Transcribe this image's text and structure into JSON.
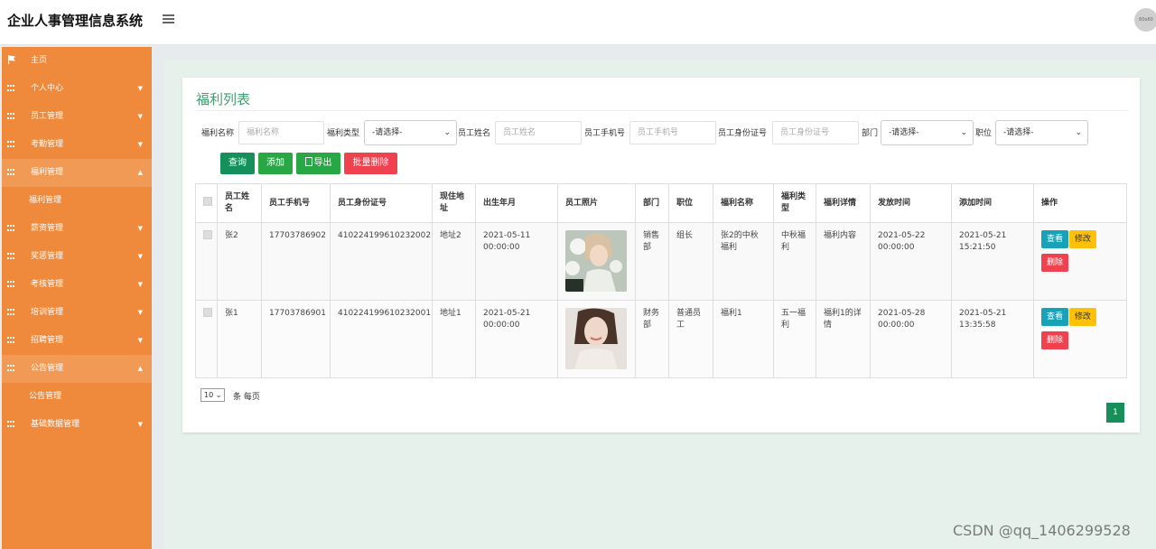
{
  "header": {
    "title": "企业人事管理信息系统",
    "avatar_text": "60x60"
  },
  "sidebar": {
    "items": [
      {
        "label": "主页",
        "icon": "flag-icon"
      },
      {
        "label": "个人中心",
        "icon": "grid-icon"
      },
      {
        "label": "员工管理",
        "icon": "grid-icon"
      },
      {
        "label": "考勤管理",
        "icon": "grid-icon"
      },
      {
        "label": "福利管理",
        "icon": "grid-icon",
        "expanded": true,
        "sub": "福利管理"
      },
      {
        "label": "薪资管理",
        "icon": "grid-icon"
      },
      {
        "label": "奖惩管理",
        "icon": "grid-icon"
      },
      {
        "label": "考核管理",
        "icon": "grid-icon"
      },
      {
        "label": "培训管理",
        "icon": "grid-icon"
      },
      {
        "label": "招聘管理",
        "icon": "grid-icon"
      },
      {
        "label": "公告管理",
        "icon": "grid-icon",
        "expanded": true,
        "sub": "公告管理"
      },
      {
        "label": "基础数据管理",
        "icon": "grid-icon"
      }
    ]
  },
  "panel": {
    "title": "福利列表"
  },
  "filters": {
    "welfare_name": {
      "label": "福利名称",
      "placeholder": "福利名称"
    },
    "welfare_type": {
      "label": "福利类型",
      "value": "-请选择-"
    },
    "emp_name": {
      "label": "员工姓名",
      "placeholder": "员工姓名"
    },
    "emp_phone": {
      "label": "员工手机号",
      "placeholder": "员工手机号"
    },
    "emp_id": {
      "label": "员工身份证号",
      "placeholder": "员工身份证号"
    },
    "dept": {
      "label": "部门",
      "value": "-请选择-"
    },
    "position": {
      "label": "职位",
      "value": "-请选择-"
    }
  },
  "buttons": {
    "query": "查询",
    "add": "添加",
    "export": "导出",
    "batch_delete": "批量删除"
  },
  "table": {
    "headers": [
      "员工姓名",
      "员工手机号",
      "员工身份证号",
      "现住地址",
      "出生年月",
      "员工照片",
      "部门",
      "职位",
      "福利名称",
      "福利类型",
      "福利详情",
      "发放时间",
      "添加时间",
      "操作"
    ],
    "rows": [
      {
        "name": "张2",
        "phone": "17703786902",
        "id_card": "410224199610232002",
        "address": "地址2",
        "birth": "2021-05-11 00:00:00",
        "dept": "销售部",
        "position": "组长",
        "welfare_name": "张2的中秋福利",
        "welfare_type": "中秋福利",
        "detail": "福利内容",
        "issue_time": "2021-05-22 00:00:00",
        "add_time": "2021-05-21 15:21:50"
      },
      {
        "name": "张1",
        "phone": "17703786901",
        "id_card": "410224199610232001",
        "address": "地址1",
        "birth": "2021-05-21 00:00:00",
        "dept": "财务部",
        "position": "普通员工",
        "welfare_name": "福利1",
        "welfare_type": "五一福利",
        "detail": "福利1的详情",
        "issue_time": "2021-05-28 00:00:00",
        "add_time": "2021-05-21 13:35:58"
      }
    ],
    "actions": {
      "view": "查看",
      "edit": "修改",
      "delete": "删除"
    }
  },
  "pager": {
    "page_size": "10",
    "per_page_text": "条 每页",
    "current_page": "1"
  },
  "watermark": "CSDN @qq_1406299528",
  "colors": {
    "sidebar": "#ef8a3d",
    "accent": "#3fa06f",
    "query": "#15905a",
    "add": "#28a745",
    "delete": "#f0414f",
    "view": "#17a2b8",
    "edit": "#ffc107"
  }
}
